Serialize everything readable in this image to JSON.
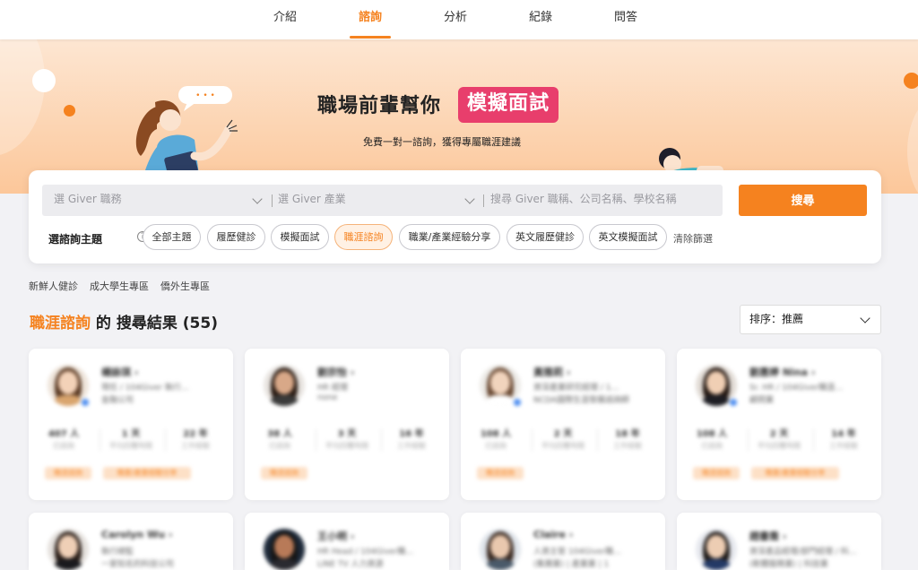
{
  "nav": {
    "tabs": [
      {
        "label": "介紹"
      },
      {
        "label": "諮詢",
        "active": true
      },
      {
        "label": "分析"
      },
      {
        "label": "紀錄"
      },
      {
        "label": "問答"
      }
    ]
  },
  "hero": {
    "title": "職場前輩幫你",
    "highlight": "模擬面試",
    "subtitle": "免費一對一諮詢，獲得專屬職涯建議",
    "speech_bubble": "• • •"
  },
  "search": {
    "field_job": "選 Giver 職務",
    "field_industry": "選 Giver 產業",
    "field_keyword": "搜尋 Giver 職稱、公司名稱、學校名稱",
    "button": "搜尋"
  },
  "topics": {
    "label": "選諮詢主題",
    "help_glyph": "?",
    "chips": [
      {
        "label": "全部主題"
      },
      {
        "label": "履歷健診"
      },
      {
        "label": "模擬面試"
      },
      {
        "label": "職涯諮詢",
        "active": true
      },
      {
        "label": "職業/產業經驗分享"
      },
      {
        "label": "英文履歷健診"
      },
      {
        "label": "英文模擬面試"
      }
    ],
    "clear": "清除篩選"
  },
  "quick_links": [
    "新鮮人健診",
    "成大學生專區",
    "僑外生專區"
  ],
  "results": {
    "topic": "職涯諮詢",
    "middle": " 的 ",
    "suffix": "搜尋結果 (55)"
  },
  "sort": {
    "label": "排序：推薦"
  },
  "cards": [
    {
      "name": "楊詠琪 ›",
      "line1": "現任 / 104Giver 執行…",
      "line2": "金融公司",
      "stats": [
        {
          "v": "407 人",
          "l": "已諮詢"
        },
        {
          "v": "1 天",
          "l": "平均回覆時間"
        },
        {
          "v": "22 年",
          "l": "工作經驗"
        }
      ],
      "tags": [
        "職涯諮詢",
        "職業/產業經驗分享"
      ]
    },
    {
      "name": "劉宗怡 ›",
      "line1": "HR 經理",
      "line2": "none",
      "stats": [
        {
          "v": "38 人",
          "l": "已諮詢"
        },
        {
          "v": "3 天",
          "l": "平均回覆時間"
        },
        {
          "v": "16 年",
          "l": "工作經驗"
        }
      ],
      "tags": [
        "職涯諮詢"
      ]
    },
    {
      "name": "黃雅莉 ›",
      "line1": "資深產業研究經理 / 1…",
      "line2": "NCDA國際生涯發展諮詢師",
      "stats": [
        {
          "v": "108 人",
          "l": "已諮詢"
        },
        {
          "v": "2 天",
          "l": "平均回覆時間"
        },
        {
          "v": "18 年",
          "l": "工作經驗"
        }
      ],
      "tags": [
        "職涯諮詢"
      ]
    },
    {
      "name": "劉惠婷 Nina ›",
      "line1": "Sr. HR / 104Giver職涯…",
      "line2": "顧問業",
      "stats": [
        {
          "v": "108 人",
          "l": "已諮詢"
        },
        {
          "v": "2 天",
          "l": "平均回覆時間"
        },
        {
          "v": "14 年",
          "l": "工作經驗"
        }
      ],
      "tags": [
        "職涯諮詢",
        "職業/產業經驗分享"
      ]
    },
    {
      "name": "Carolyn Wu ›",
      "line1": "執行總監",
      "line2": "一家知名的科技公司",
      "stats": [],
      "tags": []
    },
    {
      "name": "王小明 ›",
      "line1": "HR Head / 104Giver職…",
      "line2": "LINE TV 人力資源",
      "stats": [],
      "tags": []
    },
    {
      "name": "Claire ›",
      "line1": "人資主管 104Giver職…",
      "line2": "(集團業) | 產業業 | 1",
      "stats": [],
      "tags": []
    },
    {
      "name": "趙書喬 ›",
      "line1": "資深產品經理/部門經理 / 科…",
      "line2": "(軟體服務業) | 科技業",
      "stats": [],
      "tags": []
    }
  ]
}
